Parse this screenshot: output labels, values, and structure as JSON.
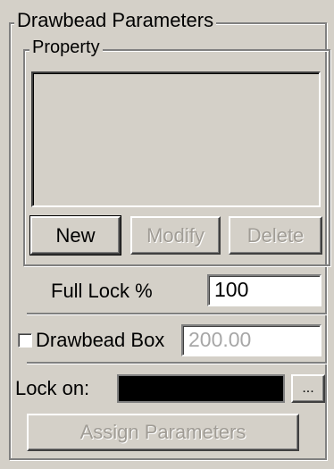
{
  "panel": {
    "group_title": "Drawbead Parameters",
    "property_title": "Property",
    "property_items": [],
    "buttons": {
      "new": "New",
      "modify": "Modify",
      "delete": "Delete"
    },
    "full_lock": {
      "label": "Full Lock %",
      "value": "100"
    },
    "drawbead_box": {
      "label": "Drawbead Box",
      "checked": false,
      "value": "200.00"
    },
    "lock_on": {
      "label": "Lock on:",
      "color": "#000000",
      "browse_label": "..."
    },
    "assign_button": "Assign Parameters"
  },
  "colors": {
    "face": "#d4d0c8",
    "disabled_text": "#a09c95",
    "disabled_field_text": "#a7a7a7"
  }
}
